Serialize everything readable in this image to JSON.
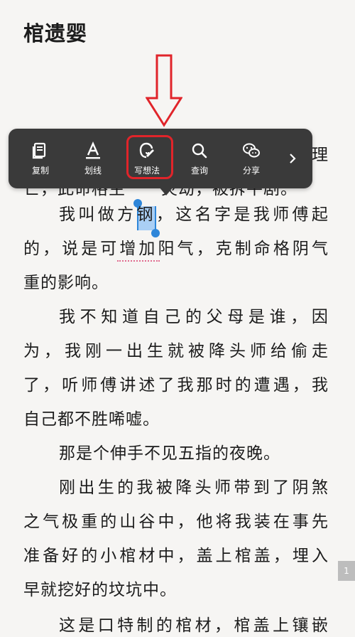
{
  "chapter_title": "棺遗婴",
  "lines": [
    {
      "text": "",
      "style": "spread"
    },
    {
      "text": "",
      "style": "spread"
    },
    {
      "text": "我叫做方钢，这名字是我师傅起",
      "style": "spread indent"
    },
    {
      "text": "的，说是可增加阳气，克制命格阴气",
      "style": "spread"
    },
    {
      "text": "重的影响。",
      "style": "left"
    },
    {
      "text": "我不知道自己的父母是谁，因",
      "style": "spread indent"
    },
    {
      "text": "为，我刚一出生就被降头师给偷走",
      "style": "spread"
    },
    {
      "text": "了，听师傅讲述了我那时的遭遇，我",
      "style": "spread"
    },
    {
      "text": "自己都不胜唏嘘。",
      "style": "left"
    },
    {
      "text": "那是个伸手不见五指的夜晚。",
      "style": "left indent"
    },
    {
      "text": "刚出生的我被降头师带到了阴煞",
      "style": "spread indent"
    },
    {
      "text": "之气极重的山谷中，他将我装在事先",
      "style": "spread"
    },
    {
      "text": "准备好的小棺材中，盖上棺盖，埋入",
      "style": "spread"
    },
    {
      "text": "早就挖好的坟坑中。",
      "style": "left"
    },
    {
      "text": "这是口特制的棺材，棺盖上镶嵌",
      "style": "spread indent"
    }
  ],
  "partial_line_right": "理",
  "partial_line_left": "亡，此命格主",
  "partial_line_left2": "灾劫，被拆平剧。",
  "toolbar": {
    "items": [
      {
        "label": "复制",
        "icon": "copy-icon"
      },
      {
        "label": "划线",
        "icon": "underline-icon"
      },
      {
        "label": "写想法",
        "icon": "note-icon"
      },
      {
        "label": "查询",
        "icon": "search-icon"
      },
      {
        "label": "分享",
        "icon": "wechat-icon"
      }
    ],
    "more_icon": "chevron-right-icon"
  },
  "selected_text": "钢",
  "page_badge": "1",
  "colors": {
    "background": "#f6f5f3",
    "toolbar": "#3a3a3a",
    "selection": "#aacff5",
    "handle": "#2e86d9",
    "annotation": "#e0242a"
  }
}
